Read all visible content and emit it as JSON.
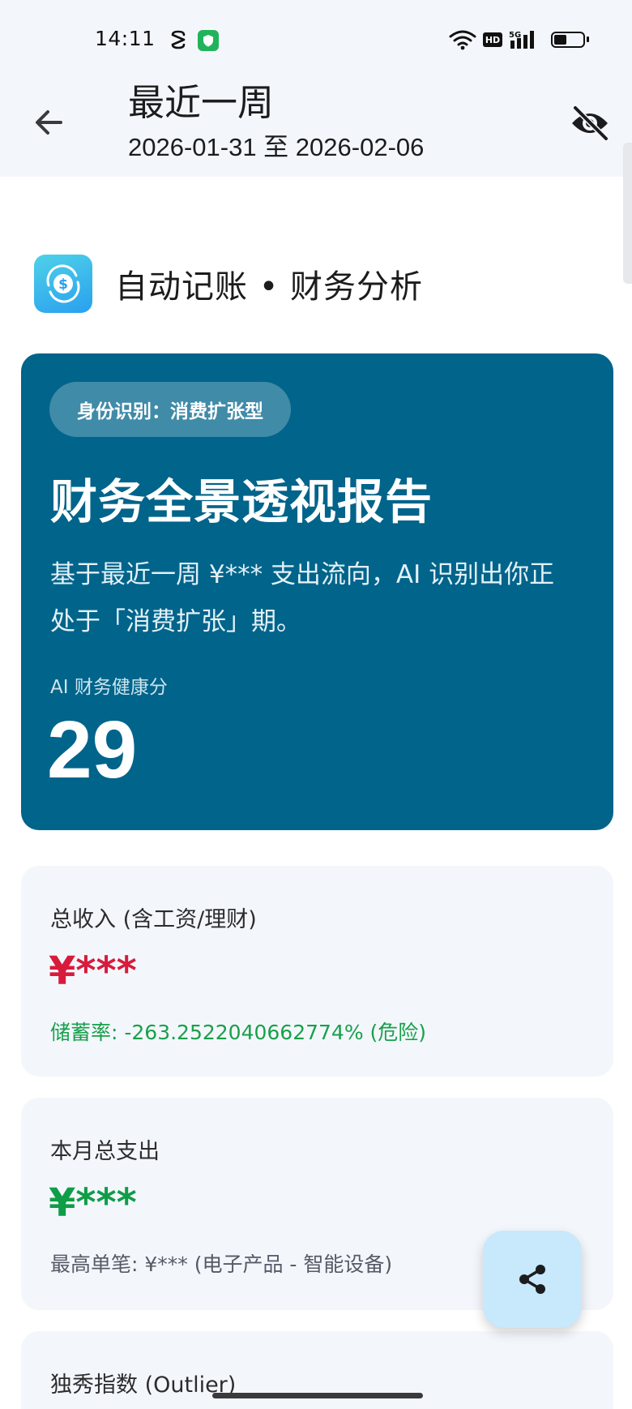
{
  "status_bar": {
    "time": "14:11",
    "network_label": "5G",
    "hd_label": "HD"
  },
  "header": {
    "title": "最近一周",
    "date_range": "2026-01-31 至 2026-02-06"
  },
  "brand": {
    "name": "自动记账 • 财务分析"
  },
  "report": {
    "identity_tag": "身份识别：消费扩张型",
    "title": "财务全景透视报告",
    "description": "基于最近一周 ¥*** 支出流向，AI 识别出你正处于「消费扩张」期。",
    "score_label": "AI 财务健康分",
    "score": "29"
  },
  "income": {
    "label": "总收入 (含工资/理财)",
    "value": "¥***",
    "savings_rate": "储蓄率: -263.2522040662774% (危险)"
  },
  "expense": {
    "label": "本月总支出",
    "value": "¥***",
    "top_item": "最高单笔: ¥*** (电子产品 - 智能设备)"
  },
  "outlier": {
    "label": "独秀指数 (Outlier)"
  },
  "colors": {
    "report_bg": "#00648b",
    "income_value": "#d81b3c",
    "expense_value": "#0f9d47",
    "savings_rate_text": "#19a04a",
    "fab_bg": "#c8e8fb"
  },
  "icons": {
    "back": "arrow-left-icon",
    "visibility": "eye-off-icon",
    "share": "share-icon",
    "brand": "dollar-cycle-icon"
  }
}
